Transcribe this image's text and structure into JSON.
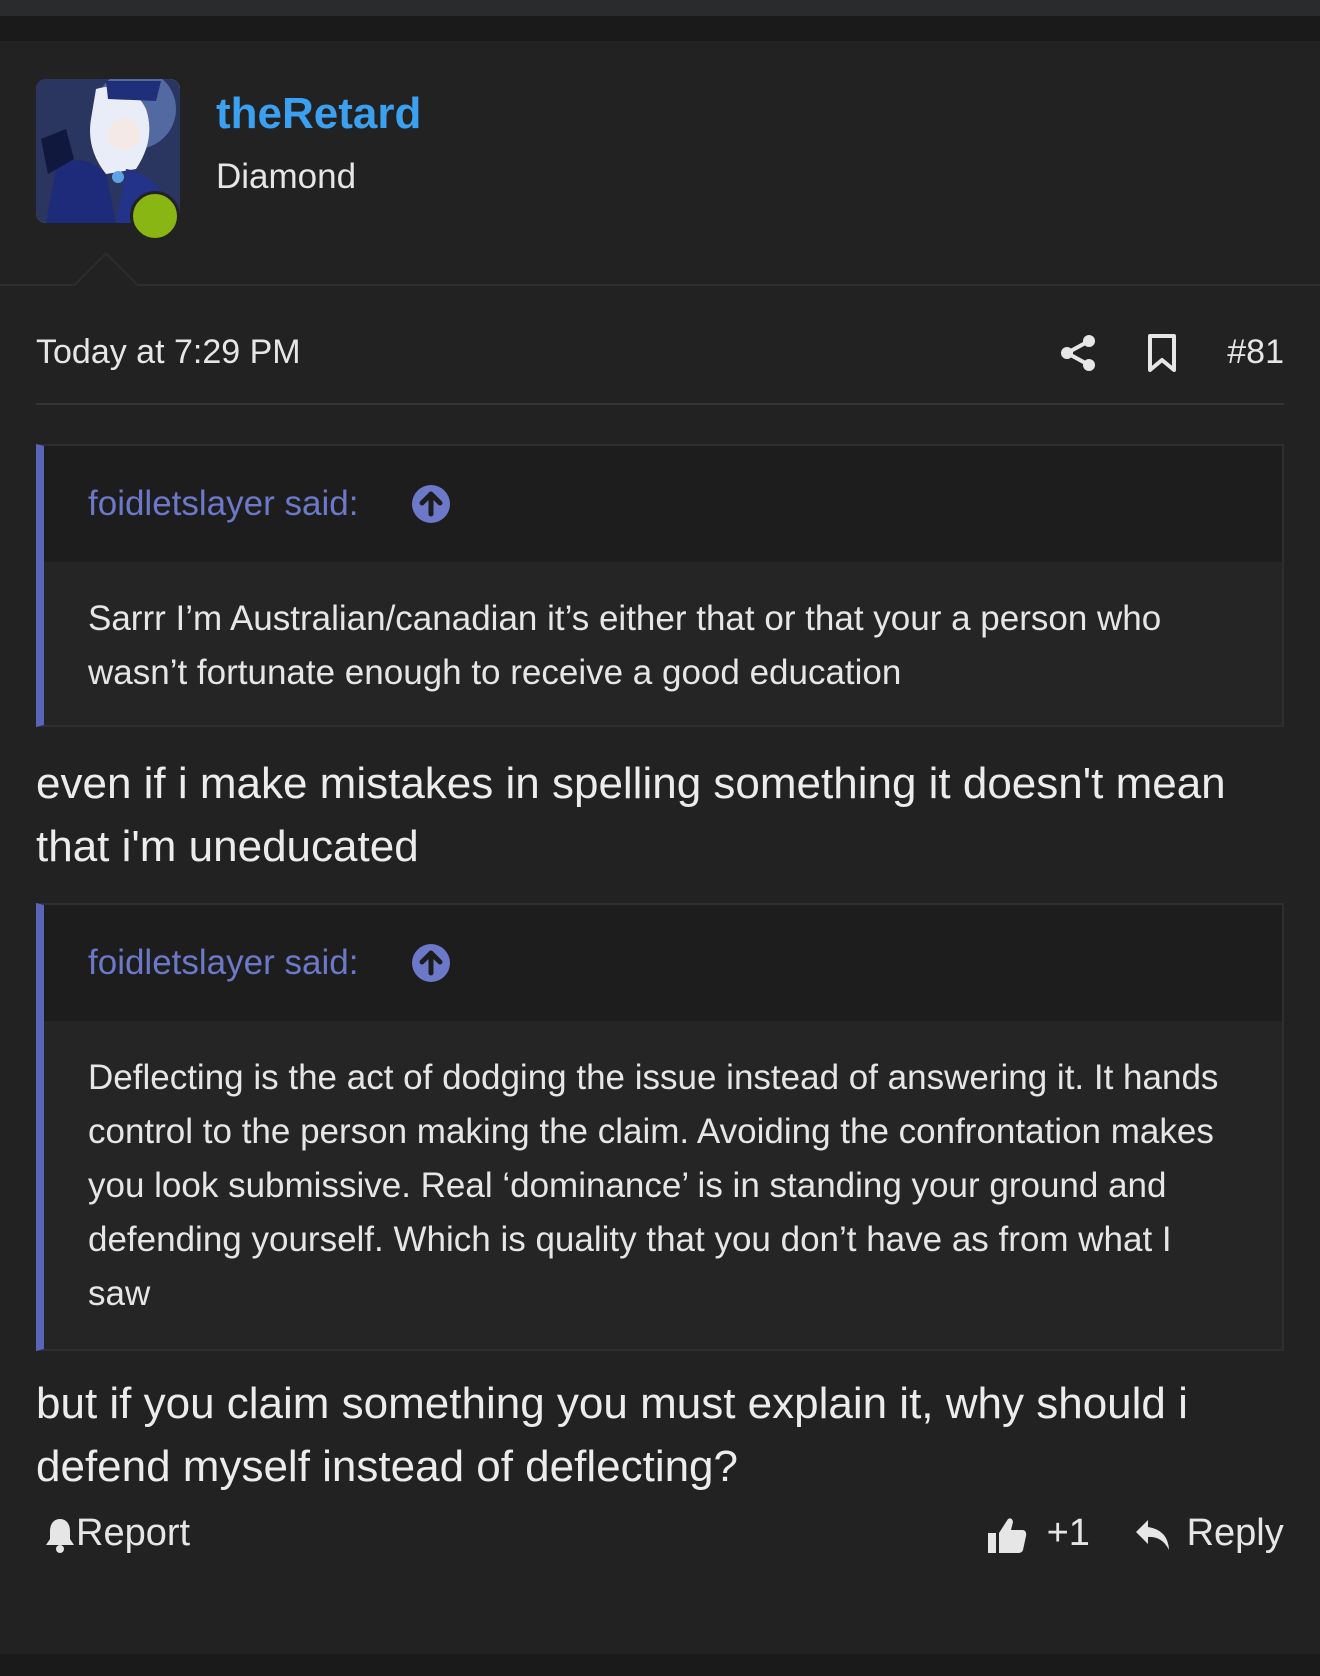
{
  "user": {
    "username": "theRetard",
    "title": "Diamond",
    "avatar_icon": "anime-character-avatar",
    "online": true
  },
  "meta": {
    "time": "Today at 7:29 PM",
    "post_number": "#81",
    "share_icon": "share-icon",
    "bookmark_icon": "bookmark-icon"
  },
  "quotes": [
    {
      "author": "foidletslayer said:",
      "text": "Sarrr I’m Australian/canadian it’s either that or that your a person who wasn’t fortunate enough to receive a good education"
    },
    {
      "author": "foidletslayer said:",
      "text": "Deflecting is the act of dodging the issue instead of answering it. It hands control to the person making the claim. Avoiding the confrontation makes you look submissive. Real ‘dominance’ is in standing your ground and defending yourself. Which is quality that you don’t have as from what I saw"
    }
  ],
  "messages": [
    "even if i make mistakes in spelling something it doesn't mean that i'm uneducated",
    "but if you claim something you must explain it, why should i defend myself instead of deflecting?"
  ],
  "footer": {
    "report_label": "Report",
    "like_label": "+1",
    "reply_label": "Reply"
  },
  "colors": {
    "username": "#3aa0ef",
    "quote_accent": "#5a64b8",
    "quote_author": "#6c78c8",
    "online": "#8ab614"
  }
}
